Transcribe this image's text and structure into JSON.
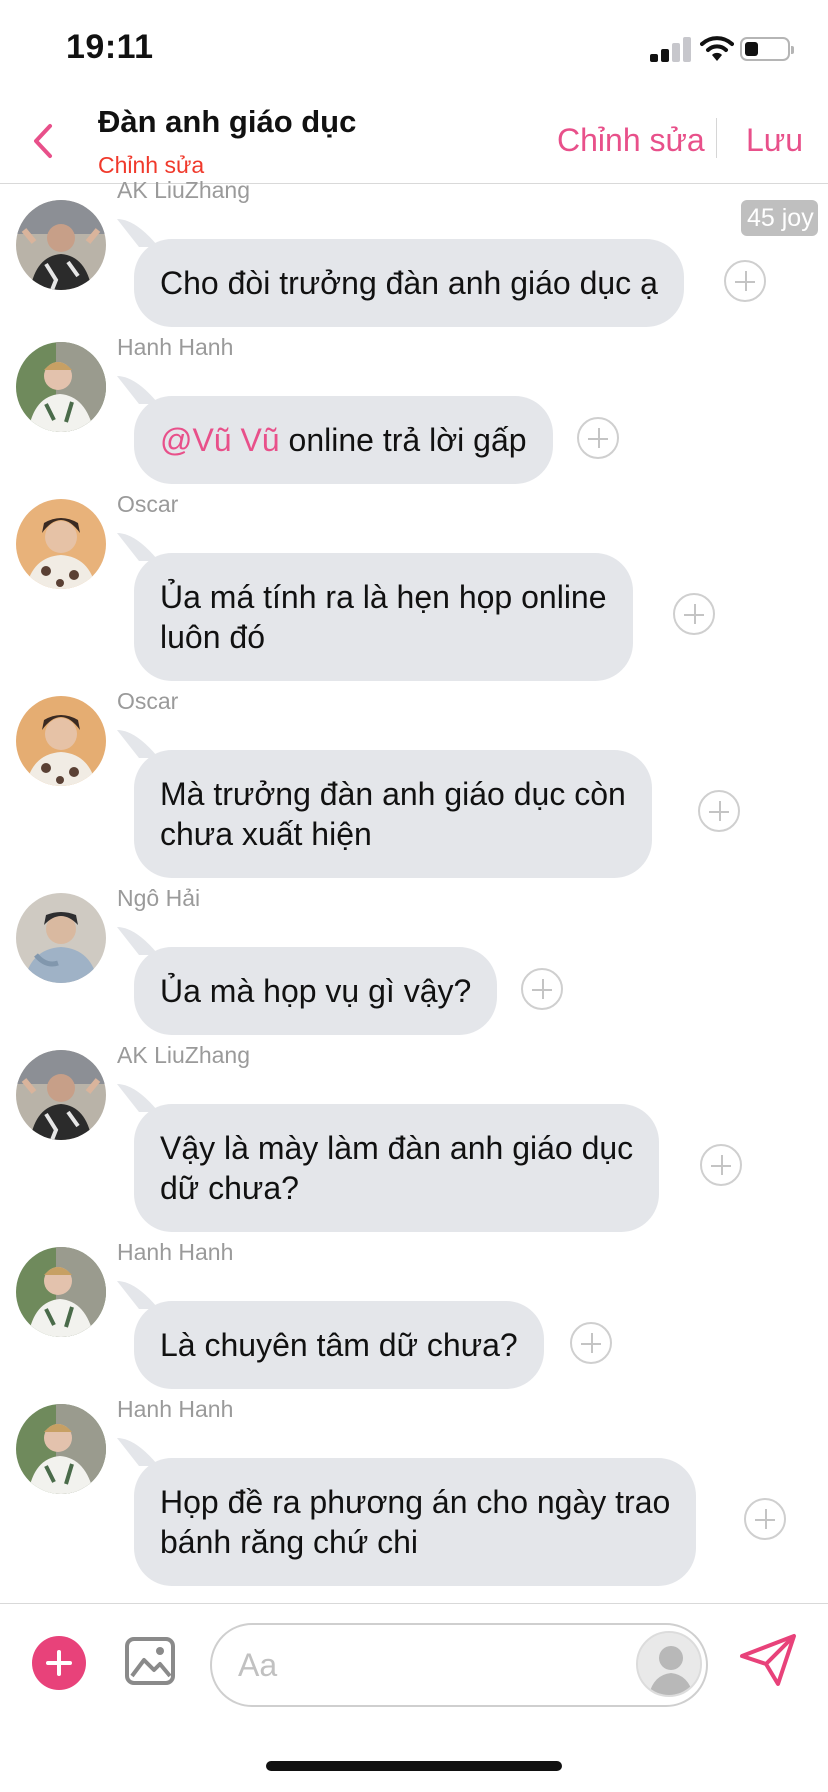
{
  "status": {
    "time": "19:11",
    "battery_fraction": 0.25
  },
  "nav": {
    "title": "Đàn anh giáo dục",
    "subtitle": "Chỉnh sửa",
    "edit": "Chỉnh sửa",
    "save": "Lưu"
  },
  "icons": {
    "back": "chevron-left-icon",
    "add": "plus-circle-icon",
    "image": "image-icon",
    "send": "paper-plane-icon"
  },
  "colors": {
    "accent": "#e8508a",
    "subtitle": "#f0392b",
    "bubble": "#e4e6ea",
    "send": "#e8427a"
  },
  "messages": [
    {
      "sender": "AK LiuZhang",
      "text": "Cho đòi trưởng đàn anh giáo dục ạ",
      "badge": "45 joy"
    },
    {
      "sender": "Hanh Hanh",
      "mention": "@Vũ Vũ",
      "text": " online trả lời gấp"
    },
    {
      "sender": "Oscar",
      "text": "Ủa má tính ra là hẹn họp online\nluôn đó"
    },
    {
      "sender": "Oscar",
      "text": "Mà trưởng đàn anh giáo dục còn\nchưa xuất hiện"
    },
    {
      "sender": "Ngô Hải",
      "text": "Ủa mà họp vụ gì vậy?"
    },
    {
      "sender": "AK LiuZhang",
      "text": "Vậy là mày làm đàn anh giáo dục\ndữ chưa?"
    },
    {
      "sender": "Hanh Hanh",
      "text": "Là chuyên tâm dữ chưa?"
    },
    {
      "sender": "Hanh Hanh",
      "text": "Họp đề ra phương án cho ngày trao\nbánh răng chứ chi"
    }
  ],
  "composer": {
    "placeholder": "Aa",
    "value": ""
  }
}
